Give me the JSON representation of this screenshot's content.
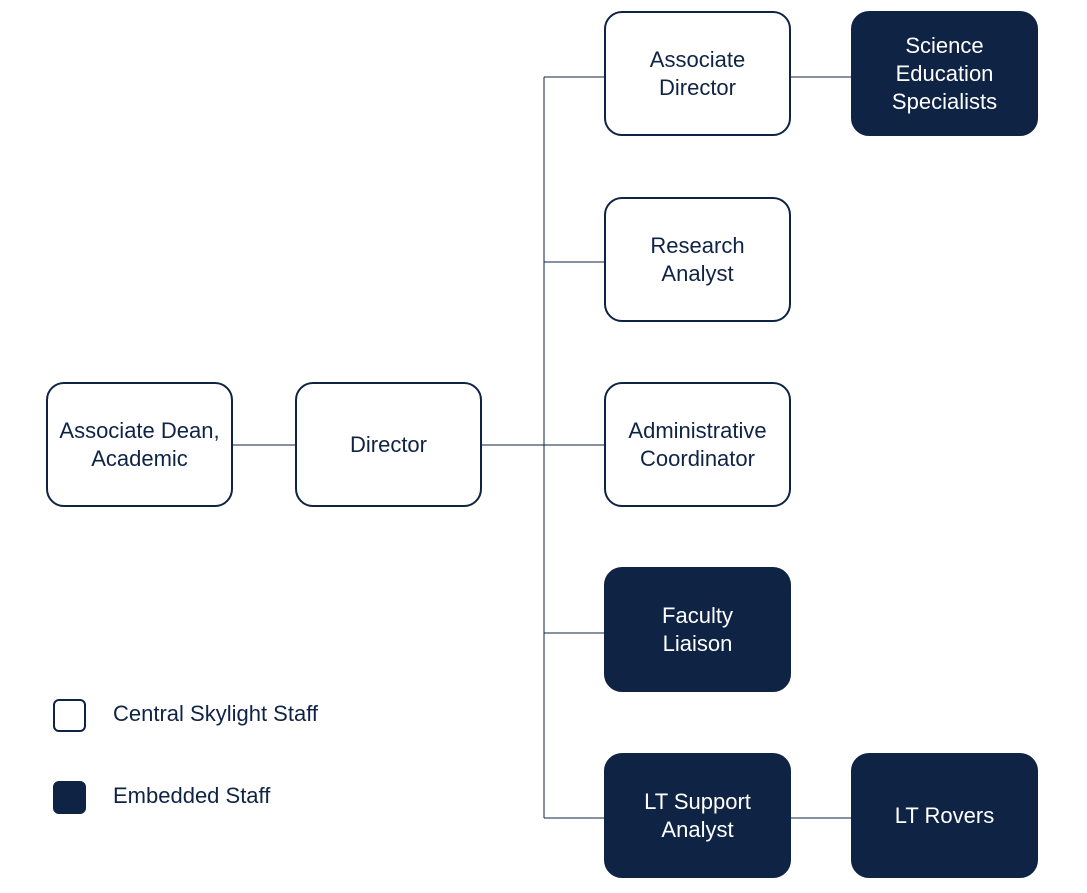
{
  "colors": {
    "navy": "#0f2344",
    "white": "#ffffff"
  },
  "nodes": {
    "associate_dean": {
      "label": "Associate Dean,\nAcademic",
      "type": "central"
    },
    "director": {
      "label": "Director",
      "type": "central"
    },
    "associate_director": {
      "label": "Associate\nDirector",
      "type": "central"
    },
    "science_education_specialists": {
      "label": "Science\nEducation\nSpecialists",
      "type": "embedded"
    },
    "research_analyst": {
      "label": "Research\nAnalyst",
      "type": "central"
    },
    "administrative_coordinator": {
      "label": "Administrative\nCoordinator",
      "type": "central"
    },
    "faculty_liaison": {
      "label": "Faculty\nLiaison",
      "type": "embedded"
    },
    "lt_support_analyst": {
      "label": "LT Support\nAnalyst",
      "type": "embedded"
    },
    "lt_rovers": {
      "label": "LT Rovers",
      "type": "embedded"
    }
  },
  "edges": [
    [
      "associate_dean",
      "director"
    ],
    [
      "director",
      "associate_director"
    ],
    [
      "director",
      "research_analyst"
    ],
    [
      "director",
      "administrative_coordinator"
    ],
    [
      "director",
      "faculty_liaison"
    ],
    [
      "director",
      "lt_support_analyst"
    ],
    [
      "associate_director",
      "science_education_specialists"
    ],
    [
      "lt_support_analyst",
      "lt_rovers"
    ]
  ],
  "legend": {
    "central": "Central Skylight Staff",
    "embedded": "Embedded Staff"
  }
}
